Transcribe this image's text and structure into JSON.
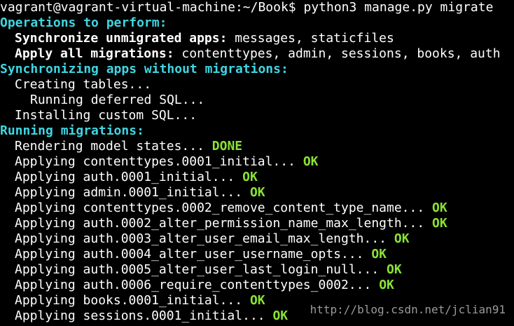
{
  "prompt": {
    "user_host_path": "vagrant@vagrant-virtual-machine:~/Book$",
    "command": "python3 manage.py migrate"
  },
  "ops_header": "Operations to perform:",
  "sync_label": "Synchronize unmigrated apps:",
  "sync_value": "messages, staticfiles",
  "apply_label": "Apply all migrations:",
  "apply_value": "contenttypes, admin, sessions, books, auth",
  "sync_header": "Synchronizing apps without migrations:",
  "creating_tables": "Creating tables...",
  "running_deferred": "Running deferred SQL...",
  "installing_custom": "Installing custom SQL...",
  "running_header": "Running migrations:",
  "rendering": {
    "text": "Rendering model states...",
    "status": "DONE"
  },
  "migrations": [
    {
      "text": "Applying contenttypes.0001_initial...",
      "status": "OK"
    },
    {
      "text": "Applying auth.0001_initial...",
      "status": "OK"
    },
    {
      "text": "Applying admin.0001_initial...",
      "status": "OK"
    },
    {
      "text": "Applying contenttypes.0002_remove_content_type_name...",
      "status": "OK"
    },
    {
      "text": "Applying auth.0002_alter_permission_name_max_length...",
      "status": "OK"
    },
    {
      "text": "Applying auth.0003_alter_user_email_max_length...",
      "status": "OK"
    },
    {
      "text": "Applying auth.0004_alter_user_username_opts...",
      "status": "OK"
    },
    {
      "text": "Applying auth.0005_alter_user_last_login_null...",
      "status": "OK"
    },
    {
      "text": "Applying auth.0006_require_contenttypes_0002...",
      "status": "OK"
    },
    {
      "text": "Applying books.0001_initial...",
      "status": "OK"
    },
    {
      "text": "Applying sessions.0001_initial...",
      "status": "OK"
    }
  ],
  "watermark": "http://blog.csdn.net/jclian91",
  "colors": {
    "header_cyan": "#3fd6e2",
    "status_green": "#8ae234",
    "text": "#ffffff",
    "background": "#000000"
  }
}
